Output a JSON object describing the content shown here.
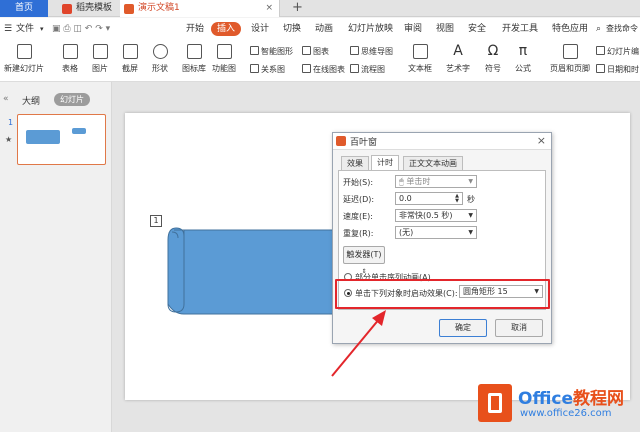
{
  "tabs": {
    "home": "首页",
    "template": "稻壳模板",
    "doc": "演示文稿1",
    "close": "×",
    "plus": "+"
  },
  "menu": {
    "file": "文件",
    "items": [
      "开始",
      "插入",
      "设计",
      "切换",
      "动画",
      "幻灯片放映",
      "审阅",
      "视图",
      "安全",
      "开发工具",
      "特色应用"
    ],
    "search": "查找命令"
  },
  "ribbon": {
    "big": [
      "新建幻灯片",
      "表格",
      "图片",
      "截屏",
      "形状",
      "图标库",
      "功能图",
      "文本框",
      "艺术字",
      "符号",
      "公式",
      "页眉和页脚"
    ],
    "small": [
      "智能图形",
      "图表",
      "思维导图",
      "关系图",
      "在线图表",
      "流程图",
      "幻灯片编",
      "日期和时"
    ]
  },
  "leftpanel": {
    "outline": "大纲",
    "slides": "幻灯片",
    "num": "1",
    "star": "★"
  },
  "slide": {
    "anim_tag": "1"
  },
  "dialog": {
    "title": "百叶窗",
    "tabs": [
      "效果",
      "计时",
      "正文文本动画"
    ],
    "start_label": "开始(S):",
    "start_value": "单击时",
    "delay_label": "延迟(D):",
    "delay_value": "0.0",
    "delay_unit": "秒",
    "speed_label": "速度(E):",
    "speed_value": "非常快(0.5 秒)",
    "repeat_label": "重复(R):",
    "repeat_value": "(无)",
    "trigger_btn": "触发器(T)",
    "opt1": "部分单击序列动画(A)",
    "opt2": "单击下列对象时启动效果(C):",
    "opt2_value": "圆角矩形 15",
    "ok": "确定",
    "cancel": "取消"
  },
  "brand": {
    "name_prefix": "Office",
    "name_suffix": "教程网",
    "url": "www.office26.com"
  },
  "colors": {
    "accent": "#e05a2b",
    "tab_blue": "#2f6fd6",
    "shape_blue": "#5b9bd5",
    "highlight_red": "#e3262b"
  }
}
